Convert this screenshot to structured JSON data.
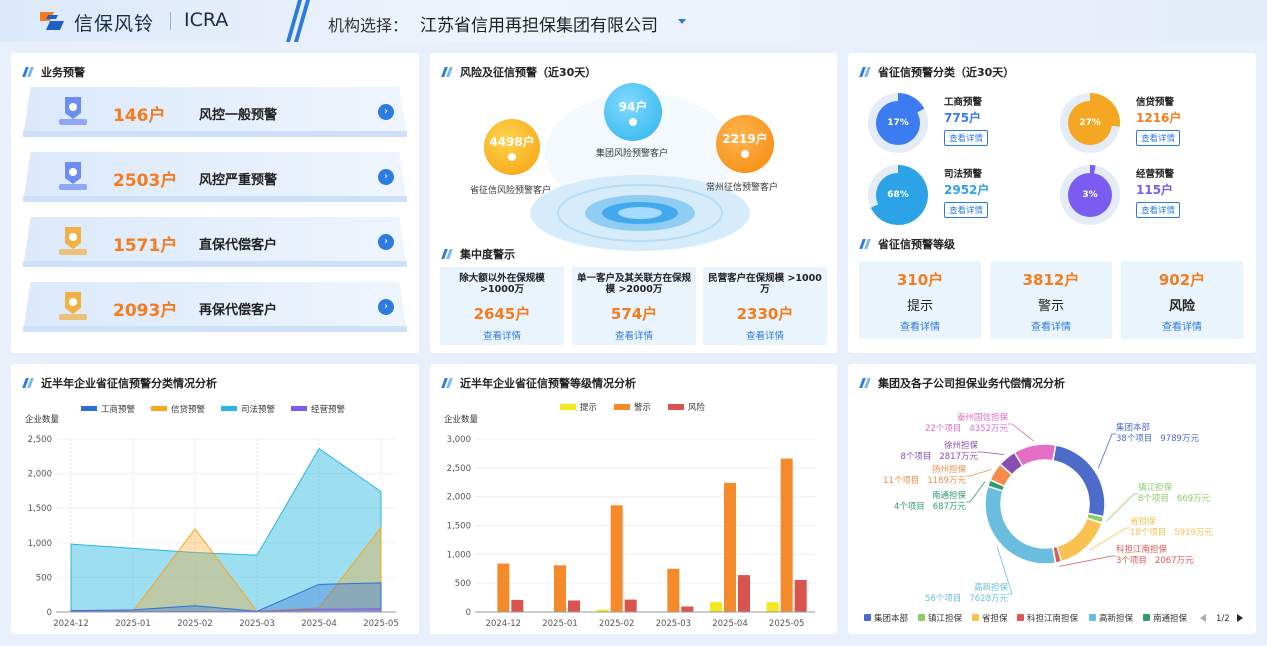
{
  "header": {
    "brand": "信保风铃",
    "brand_en": "ICRA",
    "org_label": "机构选择：",
    "org_value": "江苏省信用再担保集团有限公司"
  },
  "business_alerts": {
    "title": "业务预警",
    "items": [
      {
        "count": "146户",
        "label": "风控一般预警",
        "icon": "shield-lock-icon",
        "color": "#5b7cf0"
      },
      {
        "count": "2503户",
        "label": "风控严重预警",
        "icon": "shield-document-icon",
        "color": "#5b7cf0"
      },
      {
        "count": "1571户",
        "label": "直保代偿客户",
        "icon": "shield-coin-icon",
        "color": "#f5a623"
      },
      {
        "count": "2093户",
        "label": "再保代偿客户",
        "icon": "shield-coin-icon",
        "color": "#f5a623"
      }
    ]
  },
  "risk_alerts": {
    "title": "风险及征信预警（近30天）",
    "bubbles": [
      {
        "value": "94户",
        "label": "集团风险预警客户"
      },
      {
        "value": "4498户",
        "label": "省征信风险预警客户"
      },
      {
        "value": "2219户",
        "label": "常州征信预警客户"
      }
    ]
  },
  "concentration": {
    "title": "集中度警示",
    "cards": [
      {
        "title": "除大额以外在保规模 >1000万",
        "value": "2645户",
        "link": "查看详情"
      },
      {
        "title": "单一客户及其关联方在保规模 >2000万",
        "value": "574户",
        "link": "查看详情"
      },
      {
        "title": "民营客户在保规模 >1000万",
        "value": "2330户",
        "link": "查看详情"
      }
    ]
  },
  "classification": {
    "title": "省征信预警分类（近30天）",
    "items": [
      {
        "name": "工商预警",
        "value": "775户",
        "pct": "17%",
        "link": "查看详情",
        "color": "#3b7cf0"
      },
      {
        "name": "信贷预警",
        "value": "1216户",
        "pct": "27%",
        "link": "查看详情",
        "color": "#f5a623"
      },
      {
        "name": "司法预警",
        "value": "2952户",
        "pct": "68%",
        "link": "查看详情",
        "color": "#2ba3e6"
      },
      {
        "name": "经营预警",
        "value": "115户",
        "pct": "3%",
        "link": "查看详情",
        "color": "#7a5cf0"
      }
    ]
  },
  "levels": {
    "title": "省征信预警等级",
    "items": [
      {
        "value": "310户",
        "label": "提示",
        "link": "查看详情"
      },
      {
        "value": "3812户",
        "label": "警示",
        "link": "查看详情"
      },
      {
        "value": "902户",
        "label": "风险",
        "link": "查看详情"
      }
    ]
  },
  "area_chart": {
    "title": "近半年企业省征信预警分类情况分析",
    "chart_data": {
      "type": "area",
      "ylabel": "企业数量",
      "x": [
        "2024-12",
        "2025-01",
        "2025-02",
        "2025-03",
        "2025-04",
        "2025-05"
      ],
      "ylim": [
        0,
        2500
      ],
      "yticks": [
        "0",
        "500",
        "1,000",
        "1,500",
        "2,000",
        "2,500"
      ],
      "series": [
        {
          "name": "工商预警",
          "color": "#2d6fd8",
          "values": [
            20,
            30,
            90,
            10,
            400,
            420
          ]
        },
        {
          "name": "信贷预警",
          "color": "#f5a623",
          "values": [
            10,
            10,
            1200,
            10,
            60,
            1220
          ]
        },
        {
          "name": "司法预警",
          "color": "#29b6e0",
          "values": [
            980,
            920,
            860,
            820,
            2360,
            1740
          ]
        },
        {
          "name": "经营预警",
          "color": "#7a5cf0",
          "values": [
            5,
            5,
            5,
            5,
            40,
            45
          ]
        }
      ]
    }
  },
  "bar_chart": {
    "title": "近半年企业省征信预警等级情况分析",
    "chart_data": {
      "type": "bar",
      "ylabel": "企业数量",
      "categories": [
        "2024-12",
        "2025-01",
        "2025-02",
        "2025-03",
        "2025-04",
        "2025-05"
      ],
      "ylim": [
        0,
        3000
      ],
      "yticks": [
        "0",
        "500",
        "1,000",
        "1,500",
        "2,000",
        "2,500",
        "3,000"
      ],
      "series": [
        {
          "name": "提示",
          "color": "#f3e81c",
          "values": [
            5,
            5,
            40,
            5,
            170,
            170
          ]
        },
        {
          "name": "警示",
          "color": "#f58a2a",
          "values": [
            840,
            810,
            1850,
            750,
            2240,
            2660
          ]
        },
        {
          "name": "风险",
          "color": "#d9544f",
          "values": [
            210,
            200,
            215,
            95,
            640,
            555
          ]
        }
      ]
    }
  },
  "donut_chart": {
    "title": "集团及各子公司担保业务代偿情况分析",
    "chart_data": {
      "type": "pie",
      "series": [
        {
          "name": "集团本部",
          "projects": "38个项目",
          "amount": "9789万元",
          "value": 9789,
          "color": "#4d6cc9"
        },
        {
          "name": "镇江担保",
          "projects": "8个项目",
          "amount": "669万元",
          "value": 669,
          "color": "#8ccc6a"
        },
        {
          "name": "省担保",
          "projects": "18个项目",
          "amount": "5919万元",
          "value": 5919,
          "color": "#f9c14f"
        },
        {
          "name": "科担江南担保",
          "projects": "3个项目",
          "amount": "2067万元",
          "value": 600,
          "color": "#e15555"
        },
        {
          "name": "高新担保",
          "projects": "56个项目",
          "amount": "7628万元",
          "value": 12500,
          "color": "#6bbde0"
        },
        {
          "name": "南通担保",
          "projects": "4个项目",
          "amount": "687万元",
          "value": 687,
          "color": "#2f9e6a"
        },
        {
          "name": "扬州担保",
          "projects": "11个项目",
          "amount": "1189万元",
          "value": 1900,
          "color": "#f58a4b"
        },
        {
          "name": "徐州担保",
          "projects": "8个项目",
          "amount": "2817万元",
          "value": 1900,
          "color": "#8a4eb0"
        },
        {
          "name": "泰州国信担保",
          "projects": "22个项目",
          "amount": "4352万元",
          "value": 4352,
          "color": "#e46dc5"
        }
      ],
      "legend_visible": [
        "集团本部",
        "镇江担保",
        "省担保",
        "科担江南担保",
        "高新担保",
        "南通担保"
      ],
      "legend_page": "1/2"
    }
  }
}
